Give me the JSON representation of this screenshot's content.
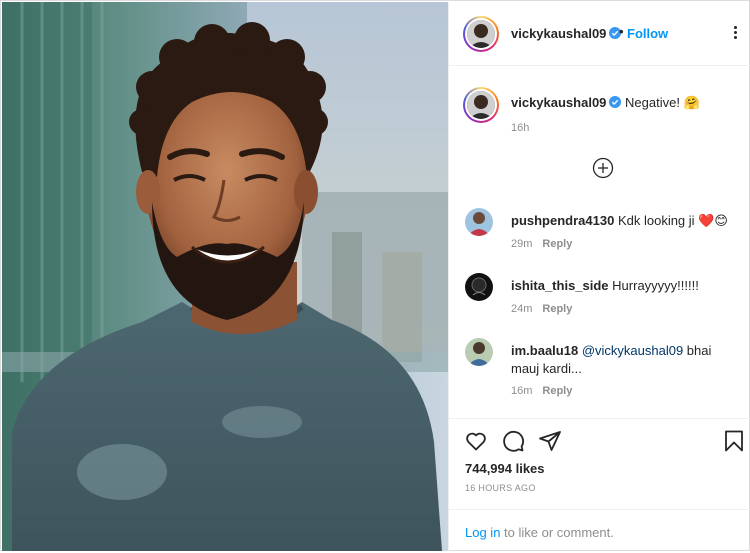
{
  "post": {
    "username": "vickykaushal09",
    "verified": true,
    "separator": "•",
    "follow_label": "Follow",
    "more_icon": "more-options-icon",
    "photo_description_icon": "portrait-photo"
  },
  "caption": {
    "username": "vickykaushal09",
    "text": "Negative!",
    "emoji": "🤗",
    "time": "16h",
    "load_more_icon": "plus-circle-icon"
  },
  "comments": [
    {
      "username": "pushpendra4130",
      "text": "Kdk looking ji",
      "emoji": "❤️😊",
      "time": "29m",
      "reply": "Reply"
    },
    {
      "username": "ishita_this_side",
      "text": "Hurrayyyyy!!!!!!",
      "emoji": "",
      "time": "24m",
      "reply": "Reply"
    },
    {
      "username": "im.baalu18",
      "mention": "@vickykaushal09",
      "text": " bhai mauj kardi...",
      "emoji": "",
      "time": "16m",
      "reply": "Reply"
    }
  ],
  "actions": {
    "like_icon": "heart-icon",
    "comment_icon": "comment-icon",
    "share_icon": "share-icon",
    "save_icon": "bookmark-icon",
    "likes": "744,994 likes",
    "posted": "16 HOURS AGO"
  },
  "login": {
    "link": "Log in",
    "rest": " to like or comment."
  },
  "colors": {
    "follow": "#0095f6",
    "secondary_text": "#8e8e8e",
    "primary_text": "#262626",
    "verified_badge": "#3897f0",
    "heart": "#e0245e"
  }
}
